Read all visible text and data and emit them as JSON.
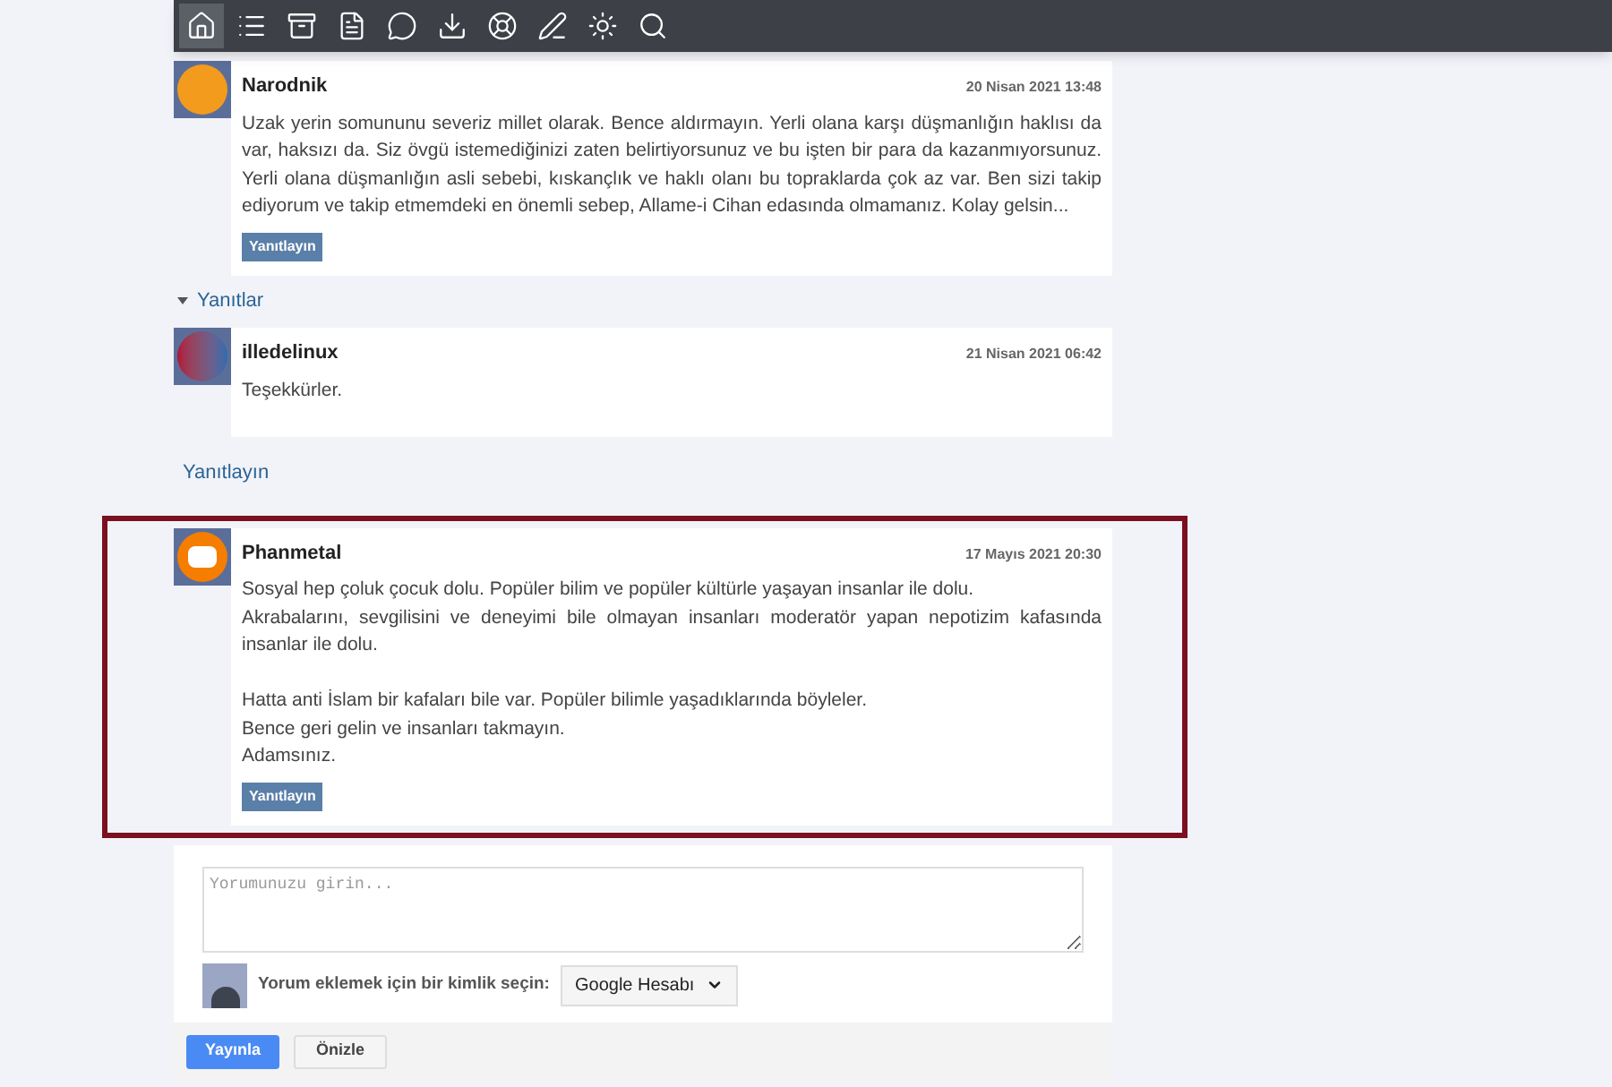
{
  "toolbar": [
    {
      "kind": "home",
      "selected": true
    },
    {
      "kind": "list",
      "selected": false
    },
    {
      "kind": "archive",
      "selected": false
    },
    {
      "kind": "document",
      "selected": false
    },
    {
      "kind": "chat",
      "selected": false
    },
    {
      "kind": "download",
      "selected": false
    },
    {
      "kind": "lifebuoy",
      "selected": false
    },
    {
      "kind": "pen",
      "selected": false
    },
    {
      "kind": "sun",
      "selected": false
    },
    {
      "kind": "search",
      "selected": false
    }
  ],
  "comments": [
    {
      "author": "Narodnik",
      "date": "20 Nisan 2021 13:48",
      "kind": "orange",
      "highlighted": false,
      "blocks": [
        [
          "Uzak yerin somununu severiz millet olarak. Bence aldırmayın. Yerli olana karşı düşmanlığın haklısı da var, haksızı da. Siz övgü istemediğinizi zaten belirtiyorsunuz ve bu işten bir para da kazanmıyorsunuz. Yerli olana düşmanlığın asli sebebi, kıskançlık ve haklı olanı bu topraklarda çok az var. Ben sizi takip ediyorum ve takip etmemdeki en önemli sebep, Allame-i Cihan edasında olmamanız. Kolay gelsin..."
        ]
      ],
      "reply_button": "Yanıtlayın",
      "replies_toggle": {
        "label": "Yanıtlar",
        "expanded": true
      },
      "children": [
        {
          "author": "illedelinux",
          "date": "21 Nisan 2021 06:42",
          "kind": "letter",
          "blocks": [
            [
              "Teşekkürler."
            ]
          ]
        }
      ],
      "reply_link": "Yanıtlayın"
    },
    {
      "author": "Phanmetal",
      "date": "17 Mayıs 2021 20:30",
      "kind": "blogger",
      "highlighted": true,
      "blocks": [
        [
          "Sosyal hep çoluk çocuk dolu. Popüler bilim ve popüler kültürle yaşayan insanlar ile dolu.",
          "Akrabalarını, sevgilisini ve deneyimi bile olmayan insanları moderatör yapan nepotizim kafasında insanlar ile dolu."
        ],
        [
          "Hatta anti İslam bir kafaları bile var. Popüler bilimle yaşadıklarında böyleler.",
          "Bence geri gelin ve insanları takmayın.",
          "Adamsınız."
        ]
      ],
      "reply_button": "Yanıtlayın"
    }
  ],
  "comment_form": {
    "placeholder": "Yorumunuzu girin...",
    "identity_label": "Yorum eklemek için bir kimlik seçin:",
    "identity": "Google Hesabı",
    "publish": "Yayınla",
    "preview": "Önizle"
  }
}
